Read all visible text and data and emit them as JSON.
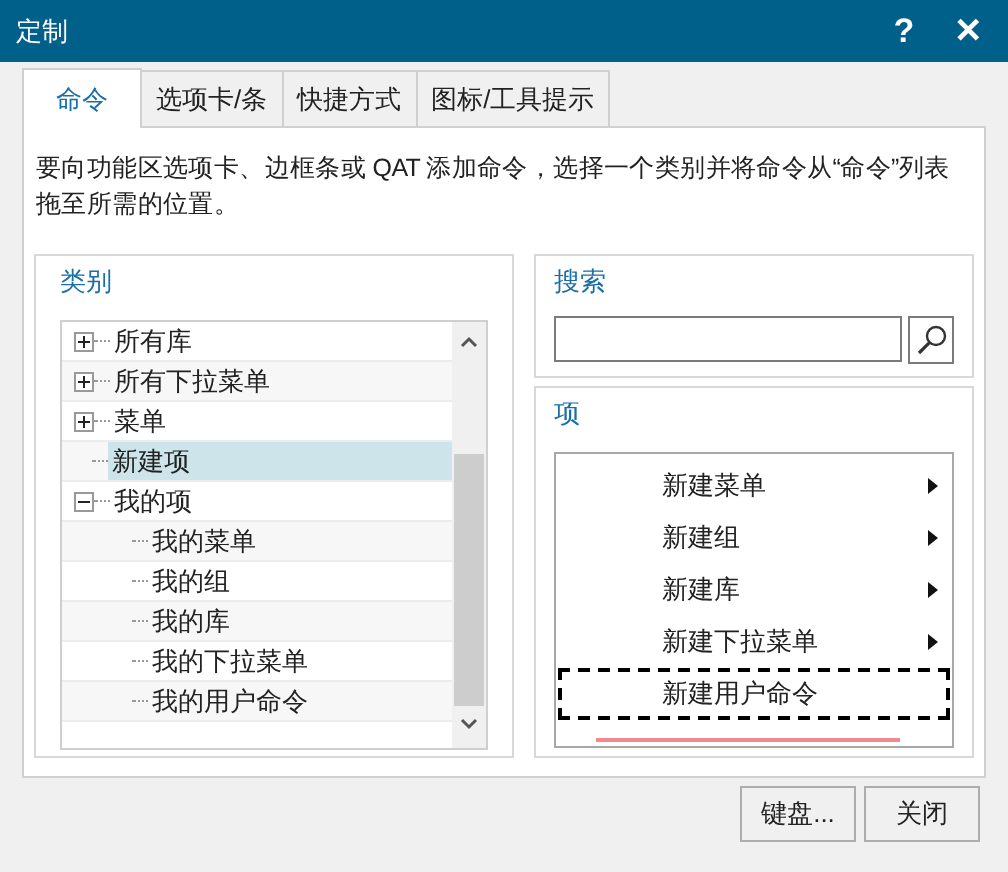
{
  "window": {
    "title": "定制",
    "help": "?",
    "close": "✕"
  },
  "tabs": [
    {
      "label": "命令",
      "selected": true
    },
    {
      "label": "选项卡/条",
      "selected": false
    },
    {
      "label": "快捷方式",
      "selected": false
    },
    {
      "label": "图标/工具提示",
      "selected": false
    }
  ],
  "description": "要向功能区选项卡、边框条或 QAT 添加命令，选择一个类别并将命令从“命令”列表拖至所需的位置。",
  "category": {
    "label": "类别",
    "tree": [
      {
        "label": "所有库",
        "expanded": false,
        "selected": false
      },
      {
        "label": "所有下拉菜单",
        "expanded": false,
        "selected": false
      },
      {
        "label": "菜单",
        "expanded": false,
        "selected": false
      },
      {
        "label": "新建项",
        "selected": true
      },
      {
        "label": "我的项",
        "expanded": true,
        "selected": false,
        "children": [
          {
            "label": "我的菜单",
            "selected": false
          },
          {
            "label": "我的组",
            "selected": false
          },
          {
            "label": "我的库",
            "selected": false
          },
          {
            "label": "我的下拉菜单",
            "selected": false
          },
          {
            "label": "我的用户命令",
            "selected": false
          }
        ]
      }
    ]
  },
  "search": {
    "label": "搜索"
  },
  "items": {
    "label": "项",
    "list": [
      {
        "label": "新建菜单",
        "submenu": true,
        "focused": false
      },
      {
        "label": "新建组",
        "submenu": true,
        "focused": false
      },
      {
        "label": "新建库",
        "submenu": true,
        "focused": false
      },
      {
        "label": "新建下拉菜单",
        "submenu": true,
        "focused": false
      },
      {
        "label": "新建用户命令",
        "submenu": false,
        "focused": true
      }
    ]
  },
  "buttons": [
    "键盘...",
    "关闭"
  ]
}
